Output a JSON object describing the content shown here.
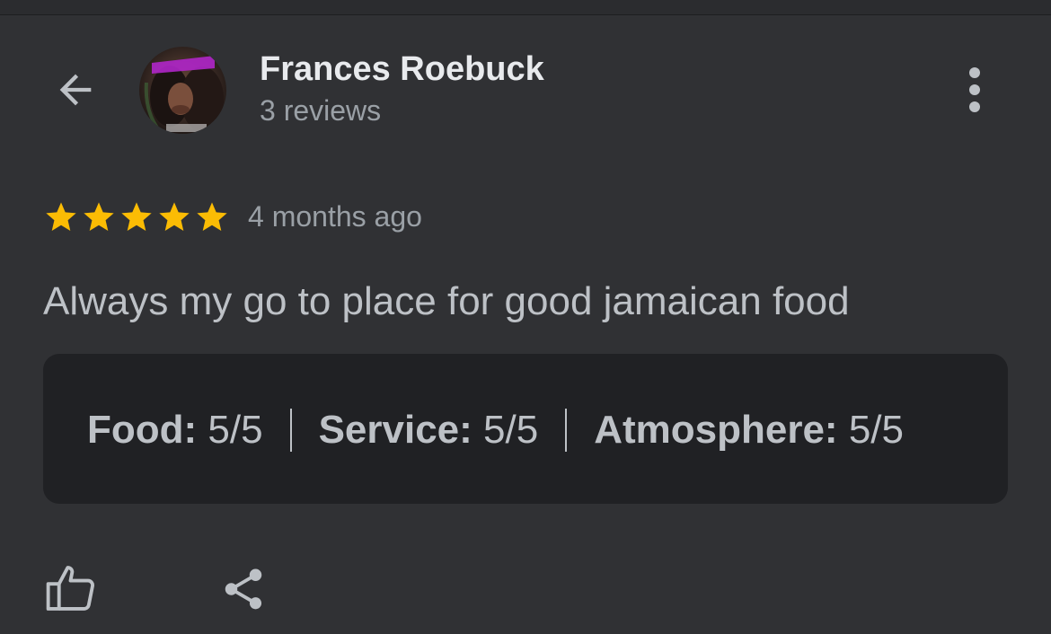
{
  "header": {
    "back_icon": "arrow-back-icon",
    "reviewer_name": "Frances Roebuck",
    "review_count": "3 reviews",
    "more_icon": "more-vertical-icon"
  },
  "review": {
    "stars": 5,
    "star_color": "#fbbc04",
    "time_ago": "4 months ago",
    "text": "Always my go to place for good jamaican food"
  },
  "ratings": [
    {
      "label": "Food:",
      "value": "5/5"
    },
    {
      "label": "Service:",
      "value": "5/5"
    },
    {
      "label": "Atmosphere:",
      "value": "5/5"
    }
  ],
  "actions": {
    "like_icon": "thumbs-up-icon",
    "share_icon": "share-icon"
  },
  "colors": {
    "background": "#303134",
    "card": "#202124",
    "primary_text": "#e8eaed",
    "secondary_text": "#9aa0a6"
  }
}
